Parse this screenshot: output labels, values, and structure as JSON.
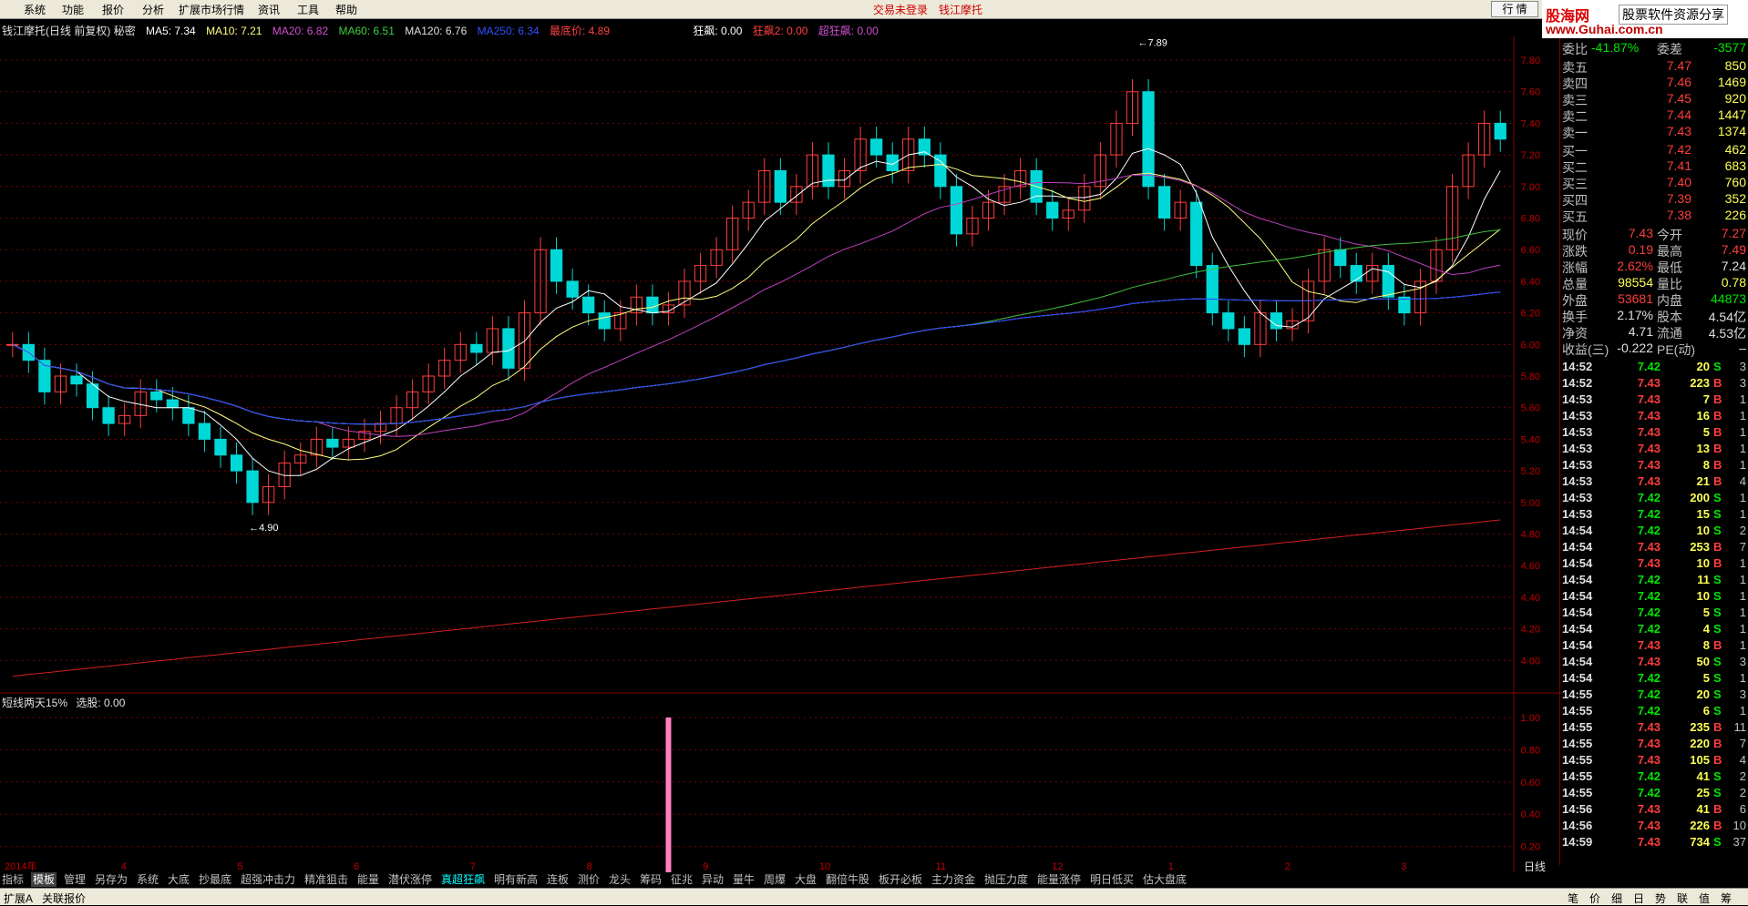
{
  "menubar": {
    "items": [
      "系统",
      "功能",
      "报价",
      "分析",
      "扩展市场行情",
      "资讯",
      "工具",
      "帮助"
    ],
    "status_not_logged": "交易未登录",
    "stock_title": "钱江摩托",
    "btn_quote": "行 情"
  },
  "logo": {
    "name": "股海网",
    "slogan": "股票软件资源分享",
    "url": "www.Guhai.com.cn"
  },
  "chart_header": {
    "stock": "钱江摩托(日线 前复权) 秘密",
    "ma5": "MA5: 7.34",
    "ma10": "MA10: 7.21",
    "ma20": "MA20: 6.82",
    "ma60": "MA60: 6.51",
    "ma120": "MA120: 6.76",
    "ma250": "MA250: 6.34",
    "lowest": "最底价: 4.89",
    "kuang": "狂飙: 0.00",
    "kuang2": "狂飙2: 0.00",
    "chao": "超狂飙: 0.00"
  },
  "chart_annotations": {
    "high": "7.89",
    "low": "4.90"
  },
  "sub_header": {
    "title": "短线两天15%",
    "select": "选股: 0.00"
  },
  "x_labels": [
    "2014年",
    "4",
    "5",
    "6",
    "7",
    "8",
    "9",
    "10",
    "11",
    "12",
    "1",
    "2",
    "3"
  ],
  "period_label": "日线",
  "colors": {
    "up": "#ff3d3d",
    "down": "#00d8d8",
    "ma5": "#ffffff",
    "ma10": "#ffff80",
    "ma20": "#c040c0",
    "ma60": "#40c040",
    "ma120": "#e0e0e0",
    "ma250": "#2040ff",
    "lowline": "#d02020",
    "bg": "#000000",
    "grid": "#800000"
  },
  "chart_data": {
    "type": "candlestick",
    "title": "钱江摩托(日线 前复权)",
    "ylim": [
      3.8,
      7.95
    ],
    "y_ticks": [
      "7.80",
      "7.60",
      "7.40",
      "7.20",
      "7.00",
      "6.80",
      "6.60",
      "6.40",
      "6.20",
      "6.00",
      "5.80",
      "5.60",
      "5.40",
      "5.20",
      "5.00",
      "4.80",
      "4.60",
      "4.40",
      "4.20",
      "4.00"
    ],
    "high": 7.89,
    "low": 4.9,
    "close_series": [
      6.0,
      5.9,
      5.7,
      5.8,
      5.75,
      5.6,
      5.5,
      5.55,
      5.7,
      5.65,
      5.6,
      5.5,
      5.4,
      5.3,
      5.2,
      5.0,
      5.1,
      5.25,
      5.3,
      5.4,
      5.35,
      5.4,
      5.45,
      5.5,
      5.6,
      5.7,
      5.8,
      5.9,
      6.0,
      5.95,
      6.1,
      5.85,
      6.2,
      6.6,
      6.4,
      6.3,
      6.2,
      6.1,
      6.2,
      6.3,
      6.2,
      6.25,
      6.4,
      6.5,
      6.6,
      6.8,
      6.9,
      7.1,
      6.9,
      7.0,
      7.2,
      7.0,
      7.1,
      7.3,
      7.2,
      7.1,
      7.3,
      7.2,
      7.0,
      6.7,
      6.8,
      6.9,
      7.0,
      7.1,
      6.9,
      6.8,
      6.85,
      7.0,
      7.2,
      7.4,
      7.6,
      7.0,
      6.8,
      6.9,
      6.5,
      6.2,
      6.1,
      6.0,
      6.2,
      6.1,
      6.15,
      6.4,
      6.6,
      6.5,
      6.4,
      6.5,
      6.3,
      6.2,
      6.4,
      6.6,
      7.0,
      7.2,
      7.4,
      7.3
    ],
    "sub_indicator": {
      "name": "短线两天15%",
      "ylim": [
        0,
        1
      ],
      "y_ticks": [
        "1.00",
        "0.80",
        "0.60",
        "0.40",
        "0.20"
      ],
      "signal_index": 41,
      "signal_value": 1.0
    }
  },
  "quote": {
    "weibi_label": "委比",
    "weibi_val": "-41.87%",
    "weicha_label": "委差",
    "weicha_val": "-3577",
    "asks": [
      {
        "label": "卖五",
        "price": "7.47",
        "vol": "850"
      },
      {
        "label": "卖四",
        "price": "7.46",
        "vol": "1469"
      },
      {
        "label": "卖三",
        "price": "7.45",
        "vol": "920"
      },
      {
        "label": "卖二",
        "price": "7.44",
        "vol": "1447"
      },
      {
        "label": "卖一",
        "price": "7.43",
        "vol": "1374"
      }
    ],
    "bids": [
      {
        "label": "买一",
        "price": "7.42",
        "vol": "462"
      },
      {
        "label": "买二",
        "price": "7.41",
        "vol": "683"
      },
      {
        "label": "买三",
        "price": "7.40",
        "vol": "760"
      },
      {
        "label": "买四",
        "price": "7.39",
        "vol": "352"
      },
      {
        "label": "买五",
        "price": "7.38",
        "vol": "226"
      }
    ],
    "stats": [
      {
        "l1": "现价",
        "v1": "7.43",
        "c1": "red",
        "l2": "今开",
        "v2": "7.27",
        "c2": "red"
      },
      {
        "l1": "涨跌",
        "v1": "0.19",
        "c1": "red",
        "l2": "最高",
        "v2": "7.49",
        "c2": "red"
      },
      {
        "l1": "涨幅",
        "v1": "2.62%",
        "c1": "red",
        "l2": "最低",
        "v2": "7.24",
        "c2": "white"
      },
      {
        "l1": "总量",
        "v1": "98554",
        "c1": "yellow",
        "l2": "量比",
        "v2": "0.78",
        "c2": "yellow"
      },
      {
        "l1": "外盘",
        "v1": "53681",
        "c1": "red",
        "l2": "内盘",
        "v2": "44873",
        "c2": "green"
      },
      {
        "l1": "换手",
        "v1": "2.17%",
        "c1": "white",
        "l2": "股本",
        "v2": "4.54亿",
        "c2": "white"
      },
      {
        "l1": "净资",
        "v1": "4.71",
        "c1": "white",
        "l2": "流通",
        "v2": "4.53亿",
        "c2": "white"
      },
      {
        "l1": "收益(三)",
        "v1": "-0.222",
        "c1": "white",
        "l2": "PE(动)",
        "v2": "–",
        "c2": "white"
      }
    ]
  },
  "ticks": [
    {
      "t": "14:52",
      "p": "7.42",
      "v": "20",
      "bs": "S",
      "n": "3"
    },
    {
      "t": "14:52",
      "p": "7.43",
      "v": "223",
      "bs": "B",
      "n": "3"
    },
    {
      "t": "14:53",
      "p": "7.43",
      "v": "7",
      "bs": "B",
      "n": "1"
    },
    {
      "t": "14:53",
      "p": "7.43",
      "v": "16",
      "bs": "B",
      "n": "1"
    },
    {
      "t": "14:53",
      "p": "7.43",
      "v": "5",
      "bs": "B",
      "n": "1"
    },
    {
      "t": "14:53",
      "p": "7.43",
      "v": "13",
      "bs": "B",
      "n": "1"
    },
    {
      "t": "14:53",
      "p": "7.43",
      "v": "8",
      "bs": "B",
      "n": "1"
    },
    {
      "t": "14:53",
      "p": "7.43",
      "v": "21",
      "bs": "B",
      "n": "4"
    },
    {
      "t": "14:53",
      "p": "7.42",
      "v": "200",
      "bs": "S",
      "n": "1"
    },
    {
      "t": "14:53",
      "p": "7.42",
      "v": "15",
      "bs": "S",
      "n": "1"
    },
    {
      "t": "14:54",
      "p": "7.42",
      "v": "10",
      "bs": "S",
      "n": "2"
    },
    {
      "t": "14:54",
      "p": "7.43",
      "v": "253",
      "bs": "B",
      "n": "7"
    },
    {
      "t": "14:54",
      "p": "7.43",
      "v": "10",
      "bs": "B",
      "n": "1"
    },
    {
      "t": "14:54",
      "p": "7.42",
      "v": "11",
      "bs": "S",
      "n": "1"
    },
    {
      "t": "14:54",
      "p": "7.42",
      "v": "10",
      "bs": "S",
      "n": "1"
    },
    {
      "t": "14:54",
      "p": "7.42",
      "v": "5",
      "bs": "S",
      "n": "1"
    },
    {
      "t": "14:54",
      "p": "7.42",
      "v": "4",
      "bs": "S",
      "n": "1"
    },
    {
      "t": "14:54",
      "p": "7.43",
      "v": "8",
      "bs": "B",
      "n": "1"
    },
    {
      "t": "14:54",
      "p": "7.43",
      "v": "50",
      "bs": "S",
      "n": "3"
    },
    {
      "t": "14:54",
      "p": "7.42",
      "v": "5",
      "bs": "S",
      "n": "1"
    },
    {
      "t": "14:55",
      "p": "7.42",
      "v": "20",
      "bs": "S",
      "n": "3"
    },
    {
      "t": "14:55",
      "p": "7.42",
      "v": "6",
      "bs": "S",
      "n": "1"
    },
    {
      "t": "14:55",
      "p": "7.43",
      "v": "235",
      "bs": "B",
      "n": "11"
    },
    {
      "t": "14:55",
      "p": "7.43",
      "v": "220",
      "bs": "B",
      "n": "7"
    },
    {
      "t": "14:55",
      "p": "7.43",
      "v": "105",
      "bs": "B",
      "n": "4"
    },
    {
      "t": "14:55",
      "p": "7.42",
      "v": "41",
      "bs": "S",
      "n": "2"
    },
    {
      "t": "14:55",
      "p": "7.42",
      "v": "25",
      "bs": "S",
      "n": "2"
    },
    {
      "t": "14:56",
      "p": "7.43",
      "v": "41",
      "bs": "B",
      "n": "6"
    },
    {
      "t": "14:56",
      "p": "7.43",
      "v": "226",
      "bs": "B",
      "n": "10"
    },
    {
      "t": "14:59",
      "p": "7.43",
      "v": "734",
      "bs": "S",
      "n": "37"
    }
  ],
  "tabs": [
    "指标",
    "模板",
    "管理",
    "另存为",
    "系统",
    "大底",
    "抄最底",
    "超强冲击力",
    "精准狙击",
    "能量",
    "潜伏涨停",
    "真超狂飙",
    "明有新高",
    "连板",
    "测价",
    "龙头",
    "筹码",
    "征兆",
    "异动",
    "量牛",
    "周爆",
    "大盘",
    "翻倍牛股",
    "板开必板",
    "主力资金",
    "抛压力度",
    "能量涨停",
    "明日低买",
    "估大盘底"
  ],
  "bottom": {
    "expand": "扩展A",
    "related": "关联报价"
  },
  "side_tabs": [
    "笔",
    "价",
    "细",
    "日",
    "势",
    "联",
    "值",
    "筹"
  ]
}
